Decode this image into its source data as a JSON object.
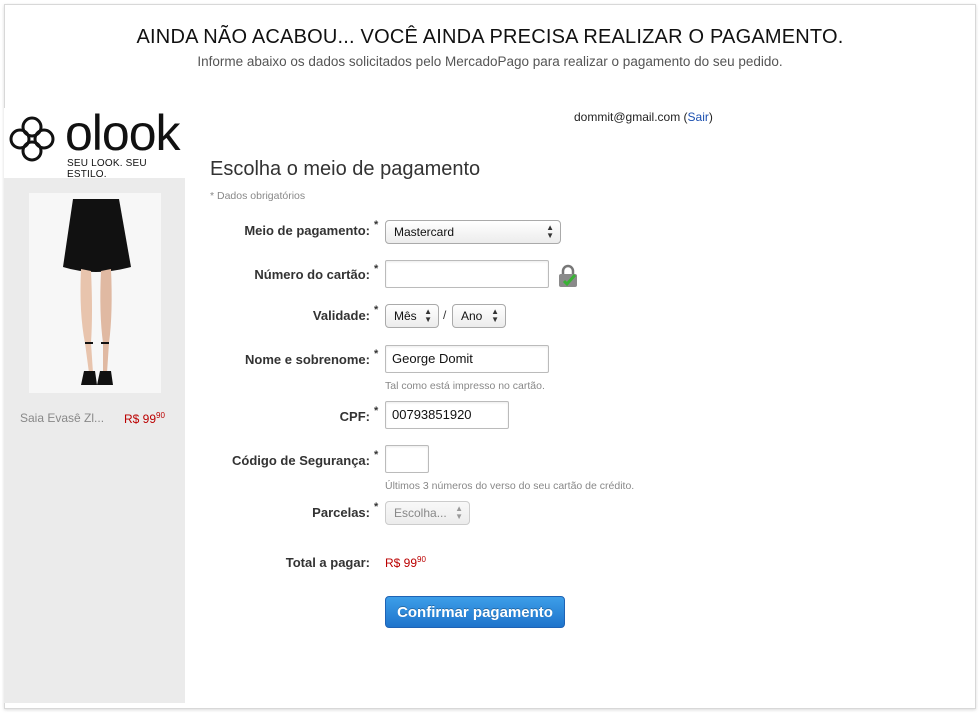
{
  "header": {
    "headline": "AINDA NÃO ACABOU... VOCÊ AINDA PRECISA REALIZAR O PAGAMENTO.",
    "subline": "Informe abaixo os dados solicitados pelo MercadoPago para realizar o pagamento do seu pedido."
  },
  "brand": {
    "name": "olook",
    "tagline": "SEU LOOK. SEU ESTILO."
  },
  "product": {
    "name": "Saia Evasê Zl...",
    "price_main": "R$ 99",
    "price_cents": "90",
    "image_icon": "skirt-product-photo"
  },
  "user": {
    "email": "dommit@gmail.com",
    "open_paren": " (",
    "logout": "Sair",
    "close_paren": ")"
  },
  "form": {
    "title": "Escolha o meio de pagamento",
    "required_note": "* Dados obrigatórios",
    "required_mark": "*",
    "payment_method": {
      "label": "Meio de pagamento:",
      "value": "Mastercard"
    },
    "card_number": {
      "label": "Número do cartão:",
      "value": ""
    },
    "validity": {
      "label": "Validade:",
      "month": "Mês",
      "separator": "/",
      "year": "Ano"
    },
    "name": {
      "label": "Nome e sobrenome:",
      "value": "George Domit",
      "hint": "Tal como está impresso no cartão."
    },
    "cpf": {
      "label": "CPF:",
      "value": "00793851920"
    },
    "security_code": {
      "label": "Código de Segurança:",
      "value": "",
      "hint": "Últimos 3 números do verso do seu cartão de crédito."
    },
    "installments": {
      "label": "Parcelas:",
      "value": "Escolha..."
    },
    "total": {
      "label": "Total a pagar:",
      "value_main": "R$ 99",
      "value_cents": "90"
    },
    "submit": "Confirmar pagamento"
  },
  "colors": {
    "price": "#bb0000",
    "button": "#1f74cc",
    "link": "#1a4fb0"
  }
}
